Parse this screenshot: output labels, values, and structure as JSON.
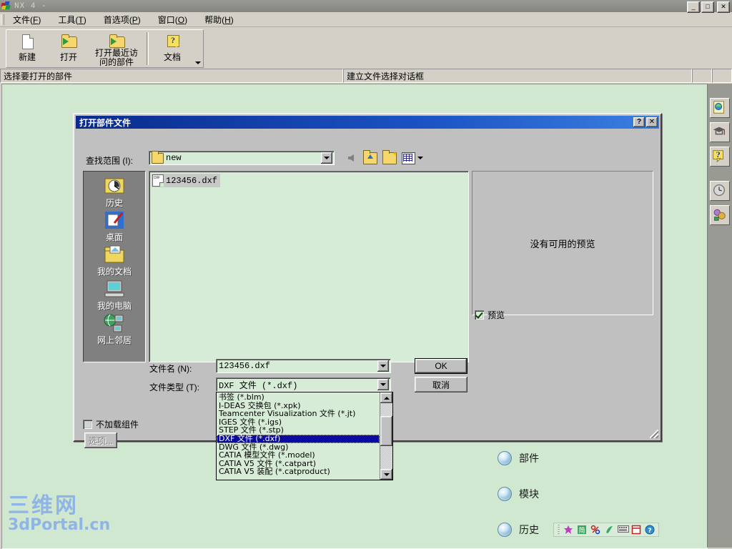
{
  "window": {
    "title": "NX 4 -",
    "minimize": "_",
    "restore": "□",
    "close": "✕"
  },
  "menubar": {
    "items": [
      {
        "label": "文件",
        "accel": "F"
      },
      {
        "label": "工具",
        "accel": "T"
      },
      {
        "label": "首选项",
        "accel": "P"
      },
      {
        "label": "窗口",
        "accel": "O"
      },
      {
        "label": "帮助",
        "accel": "H"
      }
    ]
  },
  "toolbar": {
    "buttons": [
      {
        "label": "新建",
        "icon": "new-document-icon"
      },
      {
        "label": "打开",
        "icon": "open-folder-icon"
      },
      {
        "label": "打开最近访\n问的部件",
        "icon": "open-recent-folder-icon"
      },
      {
        "label": "文档",
        "icon": "help-document-icon"
      }
    ]
  },
  "cuebar": {
    "cue": "选择要打开的部件",
    "status": "建立文件选择对话框"
  },
  "dialog": {
    "title": "打开部件文件",
    "help_btn": "?",
    "close_btn": "✕",
    "lookin_label": "查找范围 (I):",
    "lookin_value": "new",
    "nav_icons": [
      "back-arrow-icon",
      "up-one-level-icon",
      "new-folder-icon",
      "view-menu-icon"
    ],
    "files": [
      {
        "name": "123456.dxf",
        "icon": "dxf-file-icon",
        "selected": true
      }
    ],
    "places": [
      {
        "label": "历史",
        "icon": "history-icon"
      },
      {
        "label": "桌面",
        "icon": "desktop-icon"
      },
      {
        "label": "我的文档",
        "icon": "my-documents-icon"
      },
      {
        "label": "我的电脑",
        "icon": "my-computer-icon"
      },
      {
        "label": "网上邻居",
        "icon": "network-neighborhood-icon"
      }
    ],
    "preview_text": "没有可用的预览",
    "preview_checkbox": {
      "label": "预览",
      "checked": true
    },
    "noload_checkbox": {
      "label": "不加载组件",
      "checked": false
    },
    "options_button": {
      "label": "选项...",
      "disabled": true
    },
    "filename_label": "文件名 (N):",
    "filename_value": "123456.dxf",
    "filetype_label": "文件类型 (T):",
    "filetype_value": "DXF 文件 (*.dxf)",
    "filetype_options": [
      {
        "label": "书签 (*.blm)",
        "selected": false
      },
      {
        "label": "I-DEAS 交换包 (*.xpk)",
        "selected": false
      },
      {
        "label": "Teamcenter Visualization 文件 (*.jt)",
        "selected": false
      },
      {
        "label": "IGES 文件 (*.igs)",
        "selected": false
      },
      {
        "label": "STEP 文件 (*.stp)",
        "selected": false
      },
      {
        "label": "DXF 文件 (*.dxf)",
        "selected": true
      },
      {
        "label": "DWG 文件 (*.dwg)",
        "selected": false
      },
      {
        "label": "CATIA 模型文件 (*.model)",
        "selected": false
      },
      {
        "label": "CATIA V5 文件 (*.catpart)",
        "selected": false
      },
      {
        "label": "CATIA V5 装配 (*.catproduct)",
        "selected": false
      }
    ],
    "ok_button": "OK",
    "cancel_button": "取消"
  },
  "resource_bar": {
    "items": [
      {
        "label": "部件",
        "icon": "sphere-icon"
      },
      {
        "label": "模块",
        "icon": "sphere-icon"
      },
      {
        "label": "历史",
        "icon": "sphere-icon"
      }
    ],
    "tray_icons": [
      "ime-chinese-icon",
      "ime-mode-icon",
      "ime-punct-icon",
      "ime-shape-icon",
      "keyboard-icon",
      "soft-keyboard-icon",
      "ime-help-icon"
    ]
  },
  "dock": {
    "buttons": [
      {
        "icon": "part-navigator-icon"
      },
      {
        "icon": "roles-icon"
      },
      {
        "icon": "help-tip-icon"
      },
      {
        "icon": "history-palette-icon"
      },
      {
        "icon": "web-browser-icon"
      }
    ]
  },
  "watermark": {
    "cn": "三维网",
    "en": "3dPortal.cn"
  },
  "colors": {
    "dialog_titlebar": "#0a2a8c",
    "graphics_bg": "#cfe8cf",
    "chrome": "#d4d0c8",
    "selection": "#0a0a9e",
    "watermark": "#8fb4e8"
  }
}
